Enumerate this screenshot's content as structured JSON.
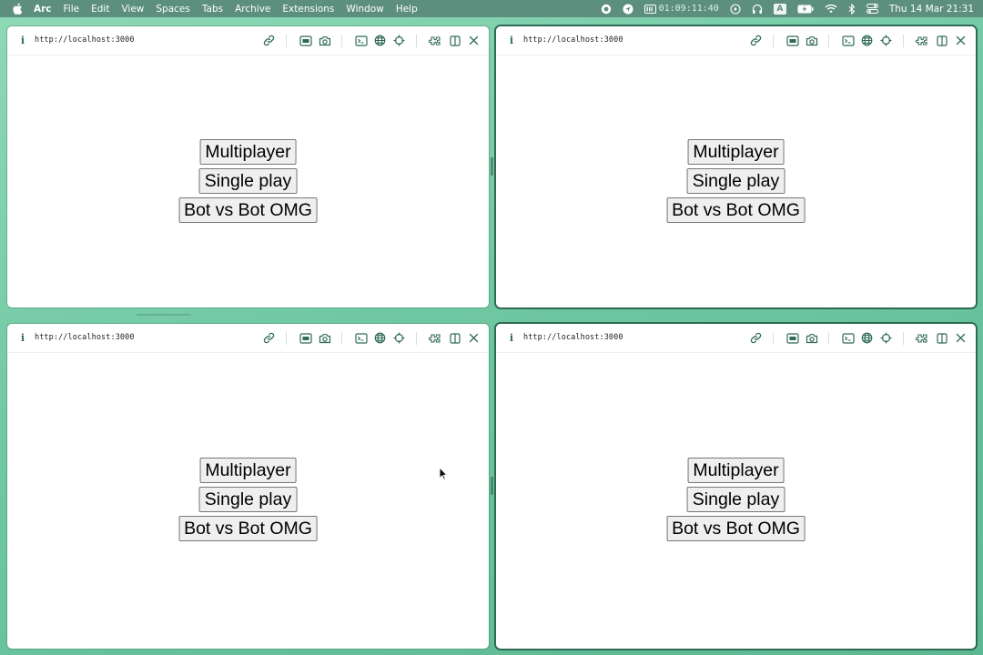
{
  "menubar": {
    "app": "Arc",
    "items": [
      "File",
      "Edit",
      "View",
      "Spaces",
      "Tabs",
      "Archive",
      "Extensions",
      "Window",
      "Help"
    ],
    "timer": "01:09:11:40",
    "keyboard_indicator": "A",
    "datetime": "Thu 14 Mar  21:31"
  },
  "panes": [
    {
      "url": "http://localhost:3000",
      "buttons": [
        "Multiplayer",
        "Single play",
        "Bot vs Bot OMG"
      ]
    },
    {
      "url": "http://localhost:3000",
      "buttons": [
        "Multiplayer",
        "Single play",
        "Bot vs Bot OMG"
      ]
    },
    {
      "url": "http://localhost:3000",
      "buttons": [
        "Multiplayer",
        "Single play",
        "Bot vs Bot OMG"
      ]
    },
    {
      "url": "http://localhost:3000",
      "buttons": [
        "Multiplayer",
        "Single play",
        "Bot vs Bot OMG"
      ]
    }
  ],
  "toolbar_icons": [
    "info-icon",
    "link-icon",
    "capture-icon",
    "camera-icon",
    "console-icon",
    "globe-icon",
    "target-icon",
    "extensions-icon",
    "split-view-icon",
    "close-icon"
  ],
  "colors": {
    "accent": "#2f6b54",
    "menubar": "#5c8f7d",
    "wallpaper": "#7fcfae",
    "button_bg": "#efefef",
    "button_border": "#767676"
  }
}
